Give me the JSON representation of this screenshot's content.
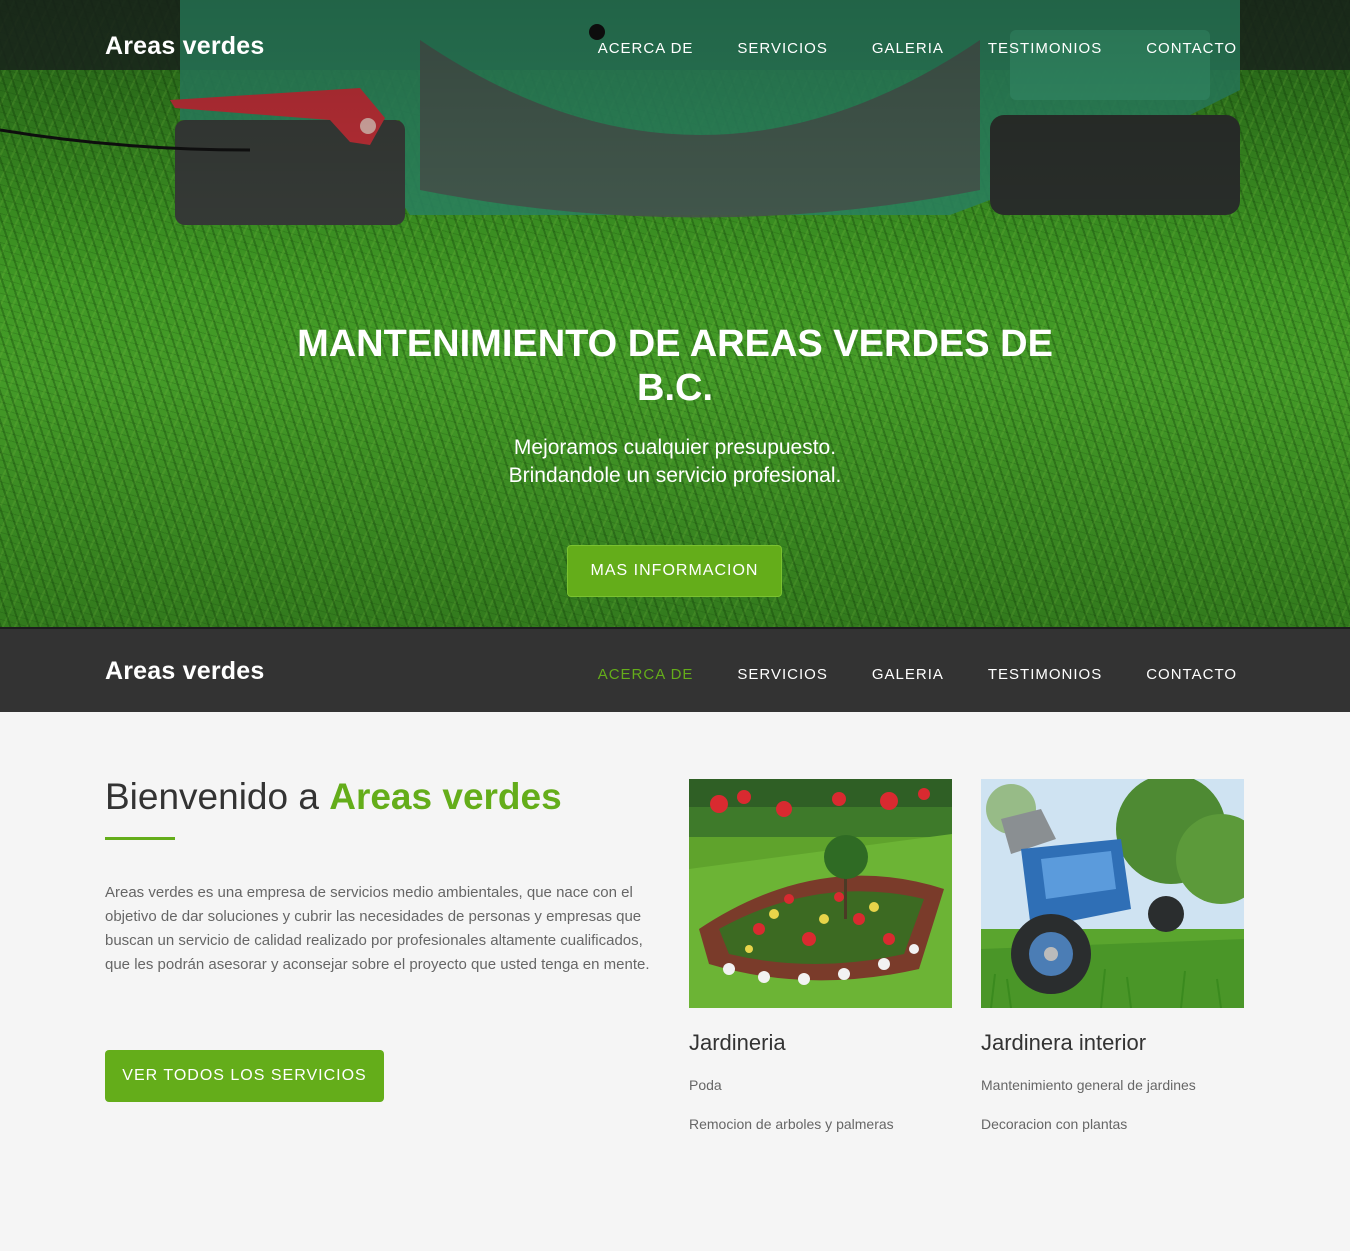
{
  "brand": "Areas verdes",
  "nav": {
    "items": [
      "ACERCA DE",
      "SERVICIOS",
      "GALERIA",
      "TESTIMONIOS",
      "CONTACTO"
    ],
    "active_color": "#64ad1a"
  },
  "hero": {
    "title": "MANTENIMIENTO DE AREAS VERDES DE B.C.",
    "subtitle_line1": "Mejoramos cualquier presupuesto.",
    "subtitle_line2": "Brindandole un servicio profesional.",
    "button": "MAS INFORMACION"
  },
  "about": {
    "title_prefix": "Bienvenido a ",
    "title_accent": "Areas verdes",
    "text": "Areas verdes es una empresa de servicios medio ambientales, que nace con el objetivo de dar soluciones y cubrir las necesidades de personas y empresas que buscan un servicio de calidad realizado por profesionales altamente cualificados, que les podrán asesorar y aconsejar sobre el proyecto que usted tenga en mente.",
    "button": "VER TODOS LOS SERVICIOS"
  },
  "cards": [
    {
      "title": "Jardineria",
      "items": [
        "Poda",
        "Remocion de arboles y palmeras"
      ]
    },
    {
      "title": "Jardinera interior",
      "items": [
        "Mantenimiento general de jardines",
        "Decoracion con plantas"
      ]
    }
  ],
  "colors": {
    "accent": "#64ad1a",
    "dark_nav": "#333333",
    "background": "#f5f5f5"
  }
}
